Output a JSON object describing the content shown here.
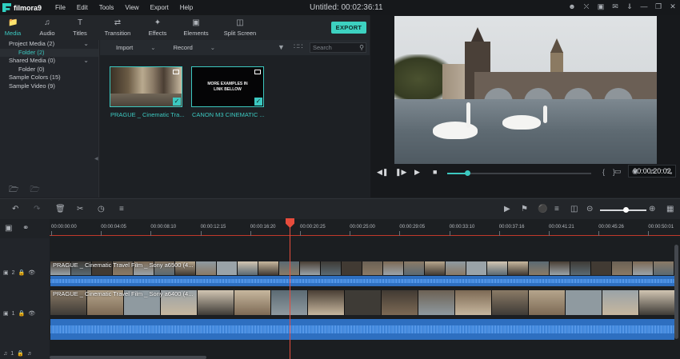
{
  "app": {
    "logo_text": "filmora9",
    "title": "Untitled:",
    "duration": "00:02:36:11",
    "menu": [
      "File",
      "Edit",
      "Tools",
      "View",
      "Export",
      "Help"
    ],
    "title_icons": [
      "account-icon",
      "store-icon",
      "save-icon",
      "mail-icon",
      "notification-icon",
      "minimize-icon",
      "restore-icon",
      "close-icon"
    ]
  },
  "toolbar": {
    "tabs": [
      {
        "label": "Media",
        "icon": "folder-icon",
        "active": true
      },
      {
        "label": "Audio",
        "icon": "music-note-icon",
        "active": false
      },
      {
        "label": "Titles",
        "icon": "text-icon",
        "active": false
      },
      {
        "label": "Transition",
        "icon": "transition-icon",
        "active": false
      },
      {
        "label": "Effects",
        "icon": "effects-icon",
        "active": false
      },
      {
        "label": "Elements",
        "icon": "image-icon",
        "active": false
      },
      {
        "label": "Split Screen",
        "icon": "split-screen-icon",
        "active": false
      }
    ],
    "export_label": "EXPORT"
  },
  "library": {
    "items": [
      {
        "label": "Project Media (2)"
      },
      {
        "label": "Folder (2)"
      },
      {
        "label": "Shared Media (0)"
      },
      {
        "label": "Folder (0)"
      },
      {
        "label": "Sample Colors (15)"
      },
      {
        "label": "Sample Video (9)"
      }
    ]
  },
  "media": {
    "import_label": "Import",
    "record_label": "Record",
    "search_placeholder": "Search",
    "clips": [
      {
        "label": "PRAGUE _ Cinematic Tra..."
      },
      {
        "label": "CANON M3 CINEMATIC ..."
      }
    ],
    "thumb_text_line1": "MORE EXAMPLES IN",
    "thumb_text_line2": "LINK BELLOW"
  },
  "preview": {
    "timecode": "00:00:20:02",
    "progress": 0.14,
    "brace_left": "{",
    "brace_right": "}"
  },
  "timeline": {
    "ruler": [
      "00:00:00:00",
      "00:00:04:05",
      "00:00:08:10",
      "00:00:12:15",
      "00:00:16:20",
      "00:00:20:25",
      "00:00:25:00",
      "00:00:29:05",
      "00:00:33:10",
      "00:00:37:16",
      "00:00:41:21",
      "00:00:45:26",
      "00:00:50:01"
    ],
    "zoom": 0.55,
    "tracks": [
      {
        "number": "2",
        "clip_title": "PRAGUE _ Cinematic Travel Film _ Sony a6500 (4..."
      },
      {
        "number": "1",
        "clip_title": "PRAGUE _ Cinematic Travel Film _ Sony a6400 (4..."
      }
    ],
    "audio_track_number": "1"
  }
}
